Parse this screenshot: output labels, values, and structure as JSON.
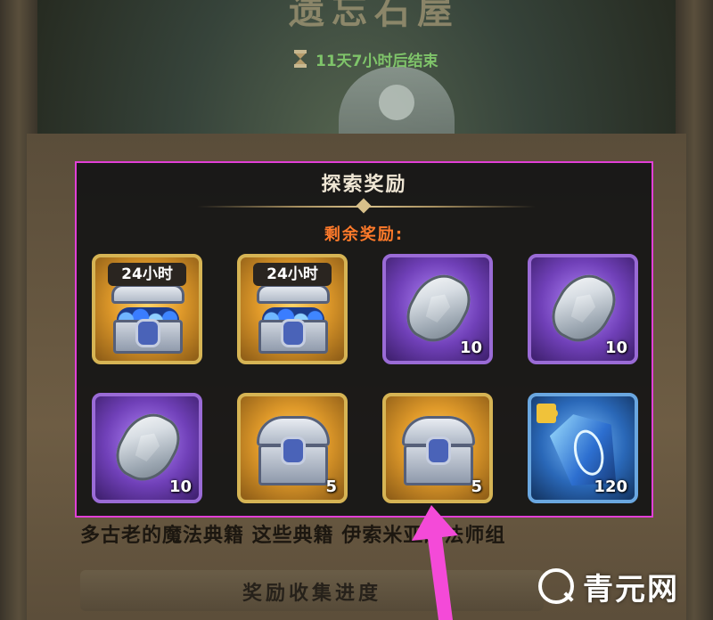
{
  "event": {
    "title": "遗忘石屋",
    "countdown": "11天7小时后结束"
  },
  "panel": {
    "title": "探索奖励",
    "remaining_label": "剩余奖励:",
    "border_color": "#e23fd7",
    "rewards": [
      {
        "type": "open-chest-icon",
        "rarity": "gold",
        "time_label": "24小时",
        "quantity": ""
      },
      {
        "type": "open-chest-icon",
        "rarity": "gold",
        "time_label": "24小时",
        "quantity": ""
      },
      {
        "type": "crystal-icon",
        "rarity": "purple",
        "time_label": "",
        "quantity": "10"
      },
      {
        "type": "crystal-icon",
        "rarity": "purple",
        "time_label": "",
        "quantity": "10"
      },
      {
        "type": "crystal-icon",
        "rarity": "purple",
        "time_label": "",
        "quantity": "10"
      },
      {
        "type": "chest-icon",
        "rarity": "gold",
        "time_label": "",
        "quantity": "5"
      },
      {
        "type": "chest-icon",
        "rarity": "gold",
        "time_label": "",
        "quantity": "5"
      },
      {
        "type": "rune-shard-icon",
        "rarity": "blue",
        "time_label": "",
        "quantity": "120"
      }
    ]
  },
  "background_text": {
    "lore_line": "多古老的魔法典籍 这些典籍 伊索米亚的法师组",
    "progress_button": "奖励收集进度"
  },
  "overlay": {
    "arrow_color": "#f44ad8",
    "watermark": "青元网"
  }
}
